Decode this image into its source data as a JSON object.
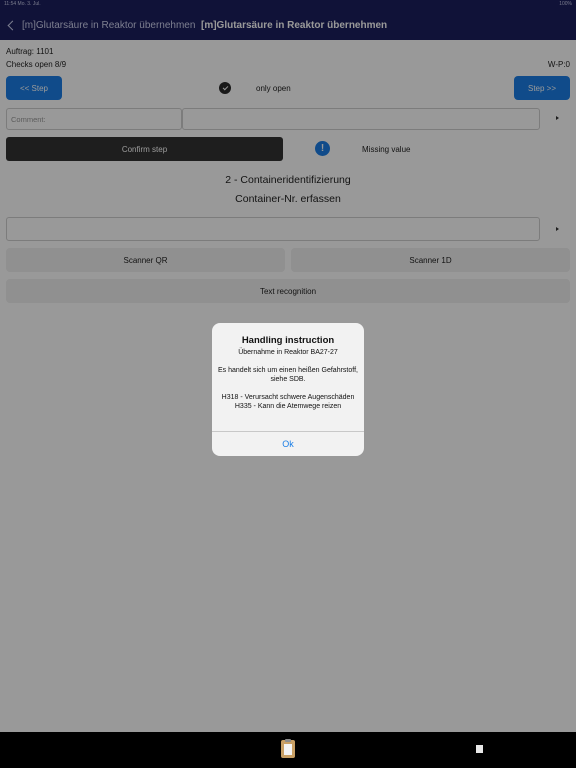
{
  "status_bar": {
    "left": "11:54  Mo. 3. Jul.",
    "right": "100%"
  },
  "nav": {
    "back_label": "[m]Glutarsäure in Reaktor übernehmen",
    "title": "[m]Glutarsäure in Reaktor übernehmen"
  },
  "order": {
    "auftrag": "Auftrag: 1101",
    "checks_open": "Checks open 8/9",
    "wp": "W-P:0"
  },
  "step_nav": {
    "prev_label": "<< Step",
    "next_label": "Step >>",
    "only_open_label": "only open"
  },
  "comment": {
    "placeholder": "Comment:"
  },
  "confirm": {
    "label": "Confirm step",
    "missing_label": "Missing value",
    "info_icon_glyph": "!"
  },
  "step": {
    "title": "2 - Containeridentifizierung",
    "subtitle": "Container-Nr. erfassen"
  },
  "scan": {
    "qr_label": "Scanner QR",
    "one_d_label": "Scanner 1D",
    "text_label": "Text recognition"
  },
  "dialog": {
    "title": "Handling instruction",
    "message": "Übernahme in Reaktor BA27-27\n\nEs handelt sich um einen heißen Gefahrstoff, siehe SDB.\n\nH318 - Verursacht schwere Augenschäden\nH335 - Kann die Atemwege reizen",
    "ok_label": "Ok"
  },
  "tabbar": {
    "icons": [
      "clipboard-icon",
      "document-icon"
    ]
  },
  "colors": {
    "nav": "#1c1f5e",
    "accent": "#1b7ee6",
    "dark_button": "#333333",
    "overlay": "rgba(0,0,0,0.4)"
  }
}
